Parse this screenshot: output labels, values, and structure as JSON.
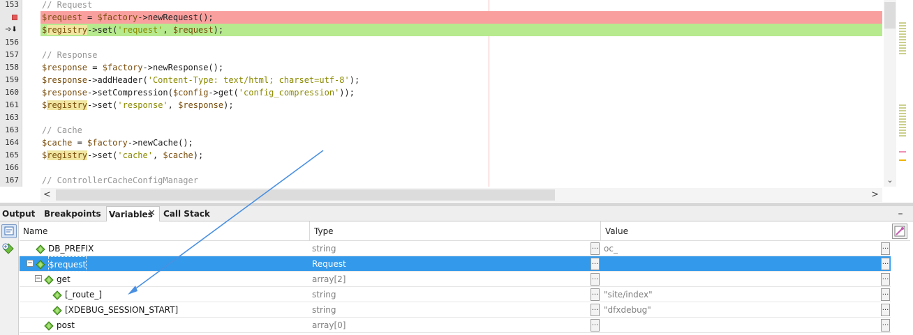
{
  "editor": {
    "lines": [
      {
        "num": "153",
        "text": "// Request",
        "kind": "comment",
        "marker": ""
      },
      {
        "num": "",
        "text": "$request = $factory->newRequest();",
        "kind": "breakpoint",
        "marker": "breakpoint"
      },
      {
        "num": "",
        "text": "$registry->set('request', $request);",
        "kind": "current",
        "marker": "current-line"
      },
      {
        "num": "156",
        "text": "",
        "kind": "code",
        "marker": ""
      },
      {
        "num": "157",
        "text": "// Response",
        "kind": "comment",
        "marker": ""
      },
      {
        "num": "158",
        "text": "$response = $factory->newResponse();",
        "kind": "code",
        "marker": ""
      },
      {
        "num": "159",
        "text": "$response->addHeader('Content-Type: text/html; charset=utf-8');",
        "kind": "code",
        "marker": ""
      },
      {
        "num": "160",
        "text": "$response->setCompression($config->get('config_compression'));",
        "kind": "code",
        "marker": ""
      },
      {
        "num": "161",
        "text": "$registry->set('response', $response);",
        "kind": "code",
        "marker": ""
      },
      {
        "num": "163",
        "text": "",
        "kind": "code",
        "marker": ""
      },
      {
        "num": "163",
        "text": "// Cache",
        "kind": "comment",
        "marker": ""
      },
      {
        "num": "164",
        "text": "$cache = $factory->newCache();",
        "kind": "code",
        "marker": ""
      },
      {
        "num": "165",
        "text": "$registry->set('cache', $cache);",
        "kind": "code",
        "marker": ""
      },
      {
        "num": "166",
        "text": "",
        "kind": "code",
        "marker": ""
      },
      {
        "num": "167",
        "text": "// ControllerCacheConfigManager",
        "kind": "comment",
        "marker": ""
      }
    ],
    "colors": {
      "breakpoint_bg": "#f9a09f",
      "current_bg": "#b7e98e",
      "variable": "#7a4d0b",
      "string": "#8a8a00",
      "comment": "#969696"
    }
  },
  "panel": {
    "tabs": [
      {
        "label": "Output",
        "active": false
      },
      {
        "label": "Breakpoints",
        "active": false
      },
      {
        "label": "Variables",
        "active": true,
        "closable": true
      },
      {
        "label": "Call Stack",
        "active": false
      }
    ],
    "close_glyph": "✕",
    "minimize_glyph": "▬"
  },
  "variables": {
    "columns": [
      "Name",
      "Type",
      "Value"
    ],
    "rows": [
      {
        "name": "DB_PREFIX",
        "type": "string",
        "value": "oc_",
        "indent": 0,
        "expander": "",
        "selected": false
      },
      {
        "name": "$request",
        "type": "Request",
        "value": "",
        "indent": 0,
        "expander": "−",
        "selected": true
      },
      {
        "name": "get",
        "type": "array[2]",
        "value": "",
        "indent": 1,
        "expander": "−",
        "selected": false
      },
      {
        "name": "[_route_]",
        "type": "string",
        "value": "\"site/index\"",
        "indent": 2,
        "expander": "",
        "selected": false
      },
      {
        "name": "[XDEBUG_SESSION_START]",
        "type": "string",
        "value": "\"dfxdebug\"",
        "indent": 2,
        "expander": "",
        "selected": false
      },
      {
        "name": "post",
        "type": "array[0]",
        "value": "",
        "indent": 1,
        "expander": "",
        "selected": false
      }
    ],
    "colors": {
      "selected_row": "#3399ea",
      "gem": "#6ebe3c"
    }
  },
  "icons": {
    "breakpoint": "breakpoint-icon",
    "current": "program-counter-icon",
    "gem": "variable-gem-icon",
    "ellipsis": "ellipsis-icon"
  }
}
